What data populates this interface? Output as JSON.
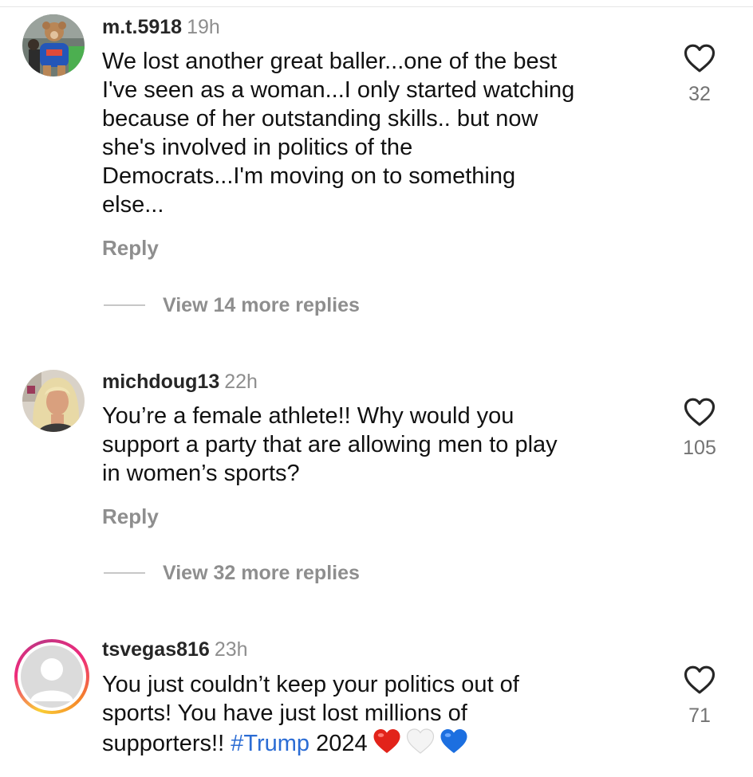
{
  "comments": [
    {
      "username": "m.t.5918",
      "time": "19h",
      "text": "We lost another great baller...one of the best\nI've seen as a woman...I only started watching\nbecause of her outstanding skills.. but now\nshe's involved in politics of the\nDemocrats...I'm moving on to something\nelse...",
      "reply_label": "Reply",
      "view_replies_label": "View 14 more replies",
      "likes": "32",
      "avatar_icon": "teddy-bear-photo"
    },
    {
      "username": "michdoug13",
      "time": "22h",
      "text": "You’re a female athlete!! Why would you\nsupport a party that are allowing men to play\nin women’s sports?",
      "reply_label": "Reply",
      "view_replies_label": "View 32 more replies",
      "likes": "105",
      "avatar_icon": "woman-photo"
    },
    {
      "username": "tsvegas816",
      "time": "23h",
      "text_before_hashtag": "You just couldn’t keep your politics out of\nsports!  You have just lost millions of\nsupporters!! ",
      "hashtag": "#Trump",
      "text_after_hashtag": " 2024",
      "emojis": [
        "red-heart",
        "white-heart",
        "blue-heart"
      ],
      "likes": "71",
      "avatar_icon": "default-profile-icon",
      "has_story_ring": true
    }
  ],
  "colors": {
    "username": "#262626",
    "meta": "#8e8e8e",
    "hashtag": "#2b6cd4",
    "like_count": "#737373"
  }
}
